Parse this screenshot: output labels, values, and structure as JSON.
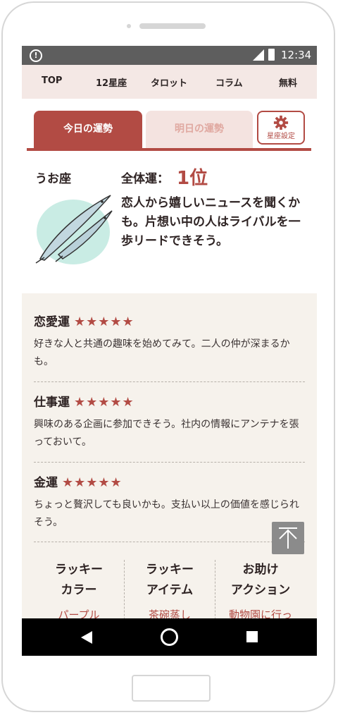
{
  "status_bar": {
    "time": "12:34",
    "alert_icon": "alert-circle-icon"
  },
  "nav": {
    "items": [
      "TOP",
      "12星座",
      "タロット",
      "コラム",
      "無料"
    ]
  },
  "tabs": {
    "today": "今日の運勢",
    "tomorrow": "明日の運勢",
    "settings": "星座設定"
  },
  "overall": {
    "sign": "うお座",
    "label": "全体運：",
    "rank": "1位",
    "text": "恋人から嬉しいニュースを聞くかも。片想い中の人はライバルを一歩リードできそう。"
  },
  "fortunes": [
    {
      "title": "恋愛運",
      "stars": "★★★★★",
      "rating": 5,
      "text": "好きな人と共通の趣味を始めてみて。二人の仲が深まるかも。"
    },
    {
      "title": "仕事運",
      "stars": "★★★★★",
      "rating": 5,
      "text": "興味のある企画に参加できそう。社内の情報にアンテナを張っておいて。"
    },
    {
      "title": "金運",
      "stars": "★★★★★",
      "rating": 5,
      "text": "ちょっと贅沢しても良いかも。支払い以上の価値を感じられそう。"
    }
  ],
  "lucky": [
    {
      "line1": "ラッキー",
      "line2": "カラー",
      "value": "パープル"
    },
    {
      "line1": "ラッキー",
      "line2": "アイテム",
      "value": "茶碗蒸し"
    },
    {
      "line1": "お助け",
      "line2": "アクション",
      "value": "動物園に行っ"
    }
  ],
  "colors": {
    "accent": "#b24b44",
    "nav_bg": "#f4e8e5",
    "details_bg": "#f6f2ec"
  }
}
